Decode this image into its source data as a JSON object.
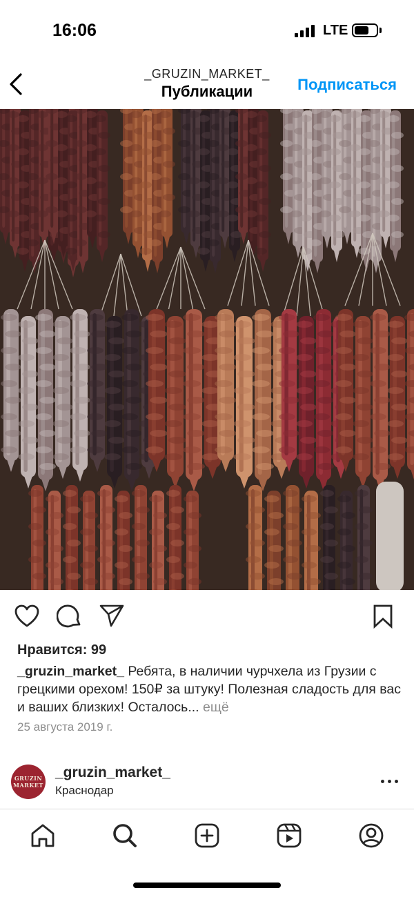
{
  "status_bar": {
    "time": "16:06",
    "carrier": "LTE"
  },
  "header": {
    "username": "_GRUZIN_MARKET_",
    "title": "Публикации",
    "follow_label": "Подписаться",
    "accent_color": "#0095f6"
  },
  "post": {
    "likes": "Нравится: 99",
    "caption_user": "_gruzin_market_",
    "caption_text": "Ребята, в наличии чурчхела из Грузии с грецкими орехом! 150₽ за штуку! Полезная сладость для вас и ваших близких! Осталось...",
    "more_label": "ещё",
    "date": "25 августа 2019 г.",
    "photo_subject": "hanging churchkhela"
  },
  "account": {
    "name": "_gruzin_market_",
    "location": "Краснодар",
    "avatar_text_1": "GRUZIN",
    "avatar_text_2": "MARKET"
  },
  "tabbar": {
    "icons": [
      "home-icon",
      "search-icon",
      "create-icon",
      "reels-icon",
      "profile-icon"
    ]
  }
}
